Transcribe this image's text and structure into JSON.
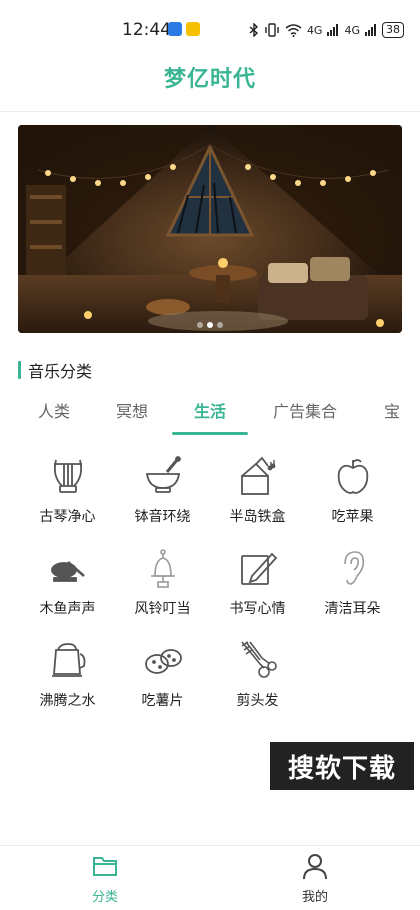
{
  "status_bar": {
    "time": "12:44",
    "network_1": "4G",
    "network_2": "4G",
    "battery": "38"
  },
  "header": {
    "title": "梦亿时代"
  },
  "section": {
    "title": "音乐分类"
  },
  "tabs": [
    {
      "label": "人类"
    },
    {
      "label": "冥想"
    },
    {
      "label": "生活",
      "active": true
    },
    {
      "label": "广告集合"
    },
    {
      "label": "宝"
    }
  ],
  "grid": [
    {
      "label": "古琴净心",
      "icon": "lyre-icon"
    },
    {
      "label": "钵音环绕",
      "icon": "mortar-icon"
    },
    {
      "label": "半岛铁盒",
      "icon": "music-box-icon"
    },
    {
      "label": "吃苹果",
      "icon": "apple-icon"
    },
    {
      "label": "木鱼声声",
      "icon": "wooden-fish-icon"
    },
    {
      "label": "风铃叮当",
      "icon": "wind-chime-icon"
    },
    {
      "label": "书写心情",
      "icon": "writing-icon"
    },
    {
      "label": "清洁耳朵",
      "icon": "ear-icon"
    },
    {
      "label": "沸腾之水",
      "icon": "kettle-icon"
    },
    {
      "label": "吃薯片",
      "icon": "potato-icon"
    },
    {
      "label": "剪头发",
      "icon": "scissors-icon"
    }
  ],
  "watermark": {
    "text": "搜软下载"
  },
  "bottom_nav": [
    {
      "label": "分类",
      "icon": "folder-icon",
      "active": true
    },
    {
      "label": "我的",
      "icon": "user-icon",
      "active": false
    }
  ],
  "colors": {
    "accent": "#3ab594",
    "text": "#222222",
    "muted": "#666666"
  }
}
